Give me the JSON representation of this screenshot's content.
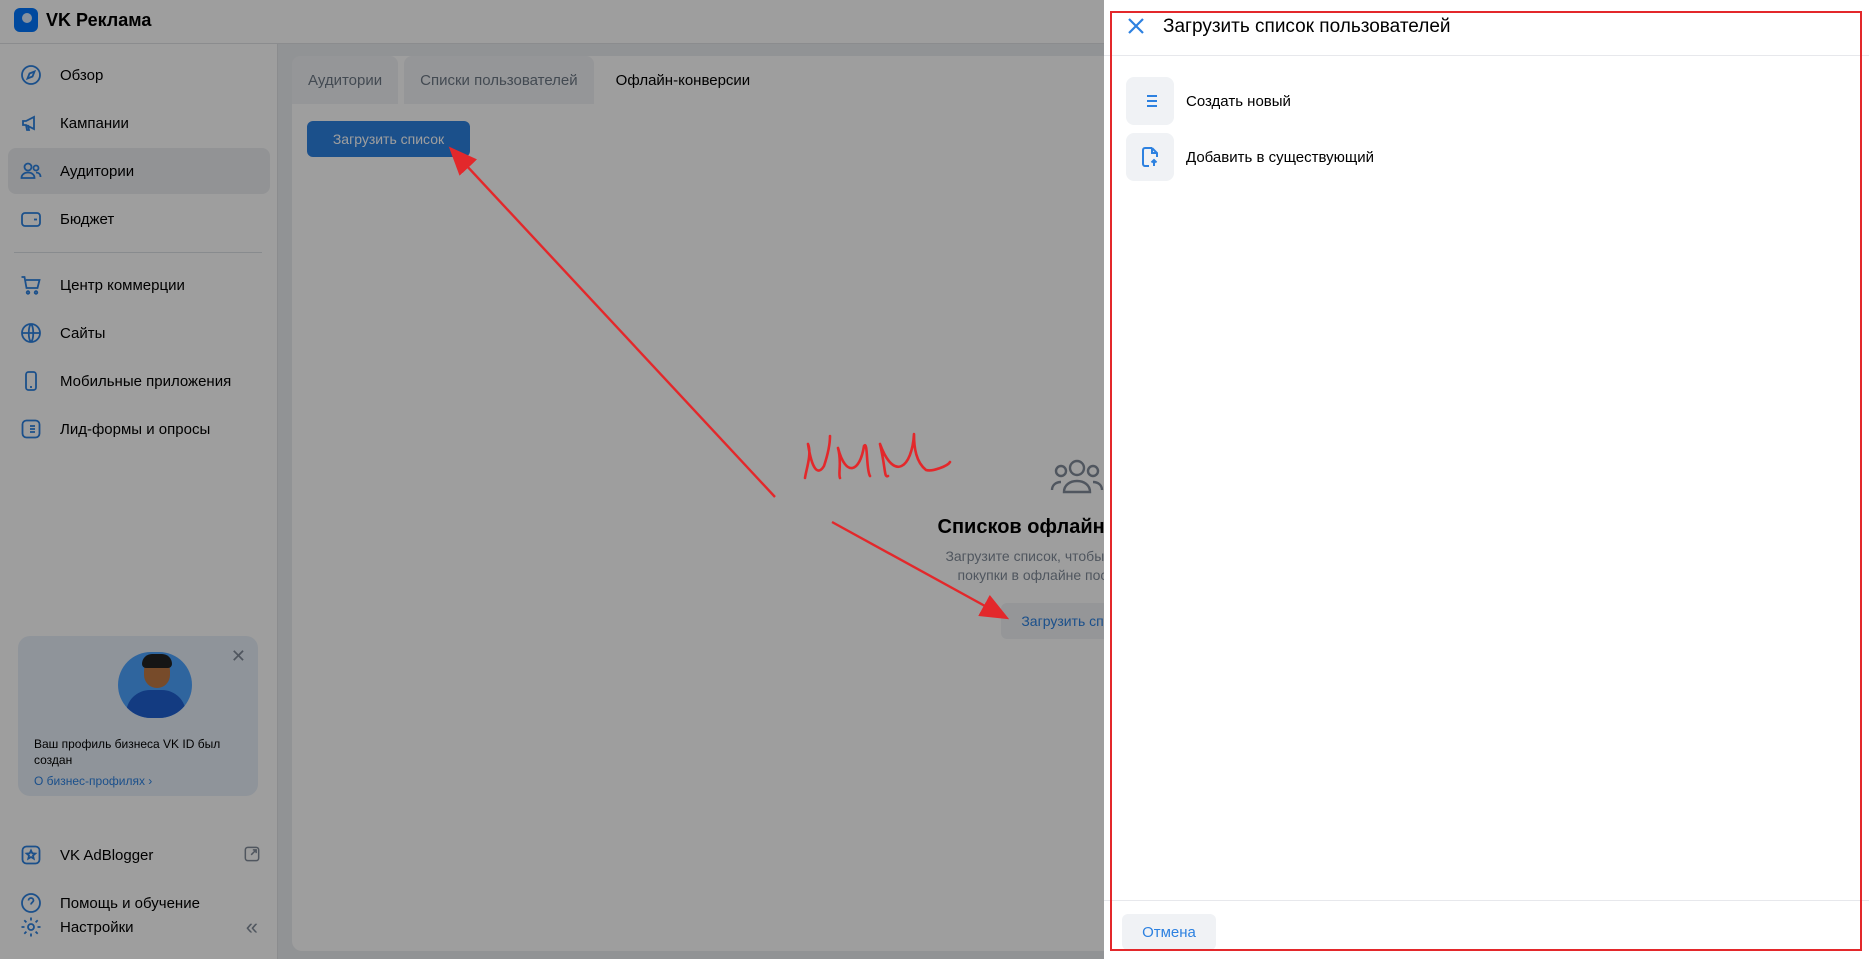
{
  "app": {
    "brand": "VK Реклама"
  },
  "sidebar": {
    "items": [
      {
        "label": "Обзор",
        "icon": "compass-icon"
      },
      {
        "label": "Кампании",
        "icon": "megaphone-icon"
      },
      {
        "label": "Аудитории",
        "icon": "users-icon",
        "active": true
      },
      {
        "label": "Бюджет",
        "icon": "wallet-icon"
      },
      {
        "label": "Центр коммерции",
        "icon": "cart-icon"
      },
      {
        "label": "Сайты",
        "icon": "globe-icon"
      },
      {
        "label": "Мобильные приложения",
        "icon": "phone-icon"
      },
      {
        "label": "Лид-формы и опросы",
        "icon": "list-icon"
      }
    ],
    "promo": {
      "text": "Ваш профиль бизнеса VK ID был создан",
      "link": "О бизнес-профилях ›",
      "close": "✕"
    },
    "bottom": [
      {
        "label": "VK AdBlogger",
        "icon": "star-icon"
      },
      {
        "label": "Помощь и обучение",
        "icon": "help-icon"
      },
      {
        "label": "Настройки",
        "icon": "gear-icon"
      }
    ],
    "collapse": "«"
  },
  "main": {
    "tabs": [
      {
        "label": "Аудитории"
      },
      {
        "label": "Списки пользователей"
      },
      {
        "label": "Офлайн-конверсии",
        "active": true
      }
    ],
    "upload_button": "Загрузить список",
    "empty": {
      "title": "Списков офлайн-конверсий",
      "desc_line1": "Загрузите список, чтобы узнать, сколько",
      "desc_line2": "покупки в офлайне после просмотра",
      "button": "Загрузить список"
    }
  },
  "drawer": {
    "title": "Загрузить список пользователей",
    "options": [
      {
        "label": "Создать новый",
        "icon": "list-icon"
      },
      {
        "label": "Добавить в существующий",
        "icon": "file-upload-icon"
      }
    ],
    "cancel": "Отмена"
  },
  "annotation": {
    "handwriting": "или",
    "color": "#e3282b"
  },
  "colors": {
    "accent": "#2d81e0",
    "annotation": "#e3282b"
  }
}
